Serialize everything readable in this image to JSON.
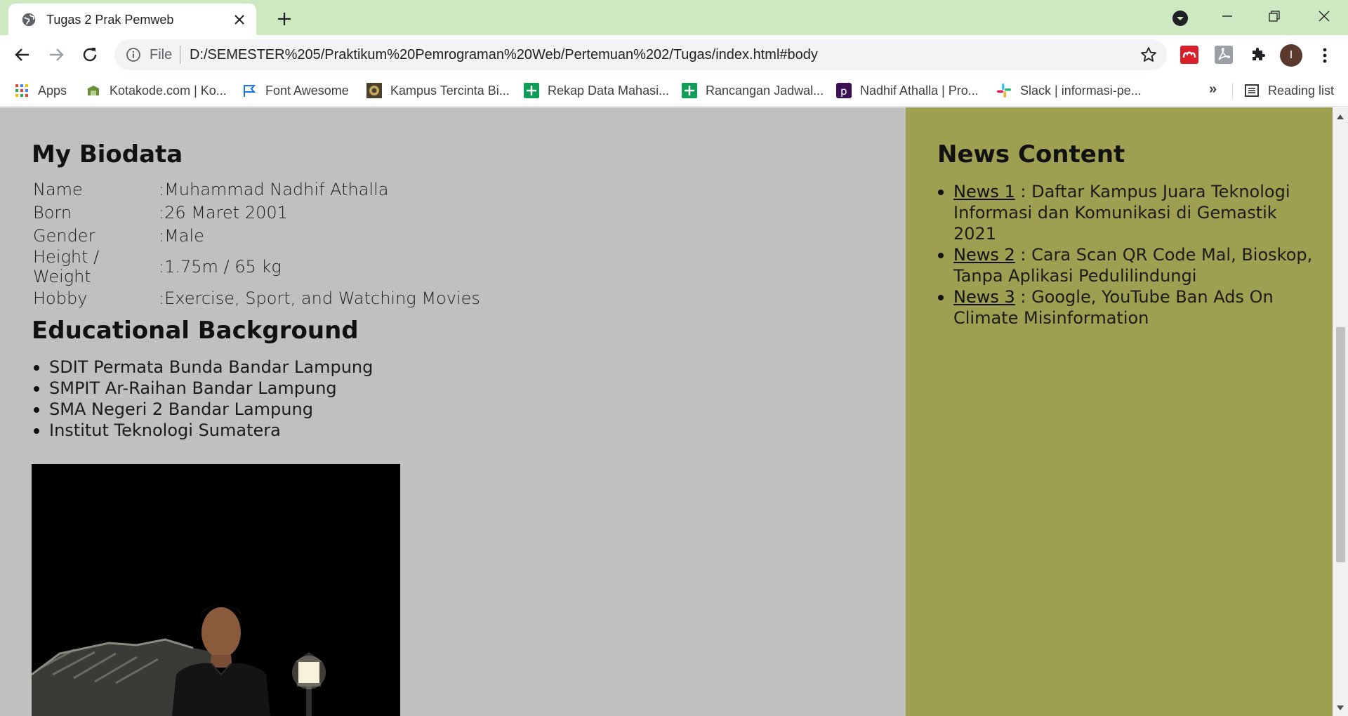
{
  "browser": {
    "tab": {
      "title": "Tugas 2 Prak Pemweb"
    },
    "omnibox": {
      "scheme_label": "File",
      "url": "D:/SEMESTER%205/Praktikum%20Pemrograman%20Web/Pertemuan%202/Tugas/index.html#body"
    },
    "profile_initial": "I",
    "bookmarks": [
      {
        "label": "Apps",
        "icon": "apps-grid-icon"
      },
      {
        "label": "Kotakode.com | Ko...",
        "icon": "kotakode-icon"
      },
      {
        "label": "Font Awesome",
        "icon": "flag-icon"
      },
      {
        "label": "Kampus Tercinta Bi...",
        "icon": "campus-icon"
      },
      {
        "label": "Rekap Data Mahasi...",
        "icon": "sheets-icon"
      },
      {
        "label": "Rancangan Jadwal...",
        "icon": "sheets-icon"
      },
      {
        "label": "Nadhif Athalla | Pro...",
        "icon": "profile-p-icon"
      },
      {
        "label": "Slack | informasi-pe...",
        "icon": "slack-icon"
      }
    ],
    "bookmarks_more": "»",
    "reading_list": "Reading list"
  },
  "page": {
    "biodata": {
      "heading": "My Biodata",
      "rows": [
        {
          "key": "Name",
          "colon": ":",
          "value": "Muhammad Nadhif Athalla"
        },
        {
          "key": "Born",
          "colon": ":",
          "value": "26 Maret 2001"
        },
        {
          "key": "Gender",
          "colon": ":",
          "value": "Male"
        },
        {
          "key": "Height / Weight",
          "colon": ":",
          "value": "1.75m / 65 kg"
        },
        {
          "key": "Hobby",
          "colon": ":",
          "value": "Exercise, Sport, and Watching Movies"
        }
      ]
    },
    "education": {
      "heading": "Educational Background",
      "items": [
        "SDIT Permata Bunda Bandar Lampung",
        "SMPIT Ar-Raihan Bandar Lampung",
        "SMA Negeri 2 Bandar Lampung",
        "Institut Teknologi Sumatera"
      ]
    },
    "news": {
      "heading": "News Content",
      "items": [
        {
          "link": "News 1",
          "text": " : Daftar Kampus Juara Teknologi Informasi dan Komunikasi di Gemastik 2021"
        },
        {
          "link": "News 2",
          "text": " : Cara Scan QR Code Mal, Bioskop, Tanpa Aplikasi Pedulilindungi"
        },
        {
          "link": "News 3",
          "text": " : Google, YouTube Ban Ads On Climate Misinformation"
        }
      ]
    }
  },
  "colors": {
    "tabstrip": "#cde9c1",
    "main_bg": "#c0c0c0",
    "aside_bg": "#9f9f52"
  }
}
